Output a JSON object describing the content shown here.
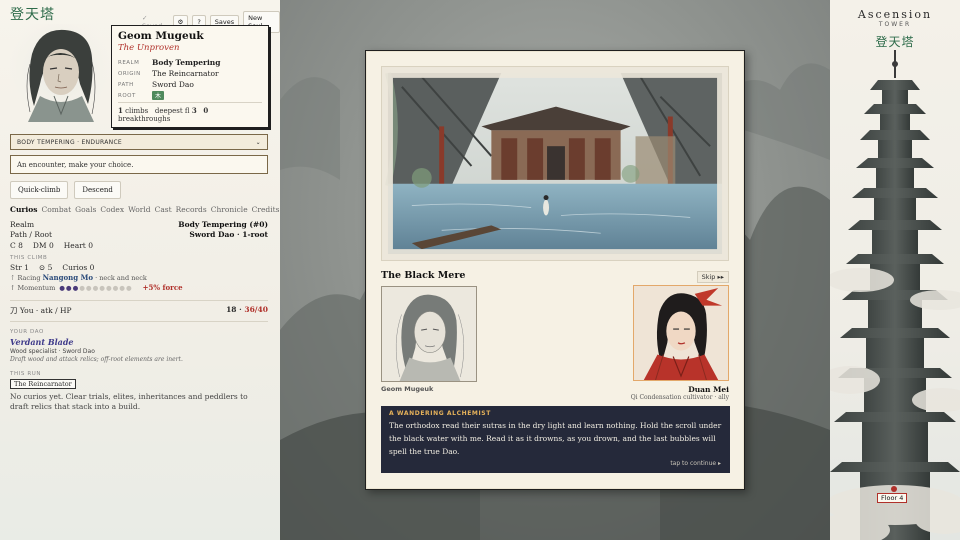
{
  "left": {
    "logo": "登天塔",
    "top_controls": {
      "saved": "✓ Saved",
      "settings": "⚙",
      "help": "?",
      "saves": "Saves",
      "new_soul": "New Soul"
    },
    "character": {
      "name": "Geom Mugeuk",
      "title": "The Unproven",
      "stats": [
        {
          "key": "REALM",
          "value": "Body Tempering"
        },
        {
          "key": "ORIGIN",
          "value": "The Reincarnator"
        },
        {
          "key": "PATH",
          "value": "Sword Dao"
        },
        {
          "key": "ROOT",
          "value": "木"
        }
      ],
      "footer": {
        "climbs_n": "1",
        "climbs_lbl": "climbs",
        "deepest_lbl": "deepest fl",
        "deepest_n": "3",
        "breaks_n": "0",
        "breaks_lbl": "breakthroughs"
      }
    },
    "realm_bar": {
      "label": "BODY TEMPERING · ENDURANCE",
      "chevron": "⌄"
    },
    "encounter_text": "An encounter, make your choice.",
    "actions": {
      "quick_climb": "Quick-climb",
      "descend": "Descend"
    },
    "tabs": [
      "Curios",
      "Combat",
      "Goals",
      "Codex",
      "World",
      "Cast",
      "Records",
      "Chronicle",
      "Credits"
    ],
    "stats": {
      "realm_lbl": "Realm",
      "realm_val": "Body Tempering (#0)",
      "path_lbl": "Path / Root",
      "path_val": "Sword Dao · 1-root",
      "c": "C 8",
      "dm": "DM 0",
      "heart": "Heart 0"
    },
    "this_climb": {
      "label": "THIS CLIMB",
      "str": "Str 1",
      "coin": "⊙ 5",
      "curios": "Curios 0",
      "racing_lbl": "⇡ Racing",
      "racing_name": "Nangong Mo",
      "racing_rest": "· neck and neck",
      "momentum_lbl": "↑ Momentum",
      "momentum_on": "●●●",
      "momentum_off": "●●●●●●●●",
      "force": "+5% force"
    },
    "hp": {
      "label": "刀 You · atk / HP",
      "atk": "18",
      "sep": " · ",
      "hp": "36/40"
    },
    "dao": {
      "label": "YOUR DAO",
      "name": "Verdant Blade",
      "sub": "Wood specialist · Sword Dao",
      "note": "Draft wood and attack relics; off-root elements are inert."
    },
    "run": {
      "label": "THIS RUN",
      "badge": "The Reincarnator"
    },
    "curios_empty": "No curios yet. Clear trials, elites, inheritances and peddlers to draft relics that stack into a build."
  },
  "encounter": {
    "title": "The Black Mere",
    "skip": "Skip ▸▸",
    "player_name": "Geom Mugeuk",
    "npc_name": "Duan Mei",
    "npc_sub": "Qi Condensation cultivator · ally",
    "dialog": {
      "speaker": "A WANDERING ALCHEMIST",
      "text": "The orthodox read their sutras in the dry light and learn nothing. Hold the scroll under the black water with me. Read it as it drowns, as you drown, and the last bubbles will spell the true Dao.",
      "continue": "tap to continue ▸"
    }
  },
  "tower": {
    "title": "Ascension",
    "subtitle": "TOWER",
    "cn": "登天塔",
    "floor_badge": "Floor 4"
  }
}
